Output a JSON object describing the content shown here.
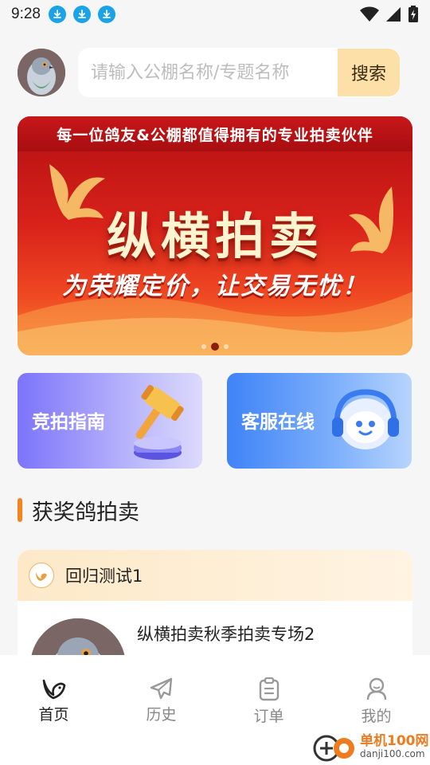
{
  "status_bar": {
    "time": "9:28",
    "notifications": [
      "download-icon",
      "download-icon",
      "download-icon"
    ],
    "right_icons": [
      "wifi-icon",
      "signal-icon",
      "battery-icon"
    ]
  },
  "header": {
    "search_placeholder": "请输入公棚名称/专题名称",
    "search_value": "",
    "search_button": "搜索"
  },
  "banner": {
    "top_text": "每一位鸽友&公棚都值得拥有的专业拍卖伙伴",
    "title": "纵横拍卖",
    "subtitle": "为荣耀定价，让交易无忧！",
    "slide_count": 3,
    "active_slide": 2
  },
  "quick_cards": [
    {
      "label": "竞拍指南",
      "icon": "gavel-icon"
    },
    {
      "label": "客服在线",
      "icon": "headset-robot-icon"
    }
  ],
  "section": {
    "title": "获奖鸽拍卖"
  },
  "auction": {
    "header_title": "回归测试1",
    "item_name": "纵横拍卖秋季拍卖专场2"
  },
  "tabbar": {
    "items": [
      {
        "label": "首页",
        "icon": "home-pigeon-icon",
        "active": true
      },
      {
        "label": "历史",
        "icon": "paper-plane-icon",
        "active": false
      },
      {
        "label": "订单",
        "icon": "clipboard-icon",
        "active": false
      },
      {
        "label": "我的",
        "icon": "user-icon",
        "active": false
      }
    ]
  },
  "watermark": {
    "cn": "单机100网",
    "en": "danji100.com"
  },
  "colors": {
    "accent_orange": "#f5841f",
    "search_button_bg": "#fde0a8",
    "banner_red": "#d8221a",
    "card_guide": "#7c74fb",
    "card_service": "#3f83f8",
    "download_badge": "#1aa3e8"
  }
}
